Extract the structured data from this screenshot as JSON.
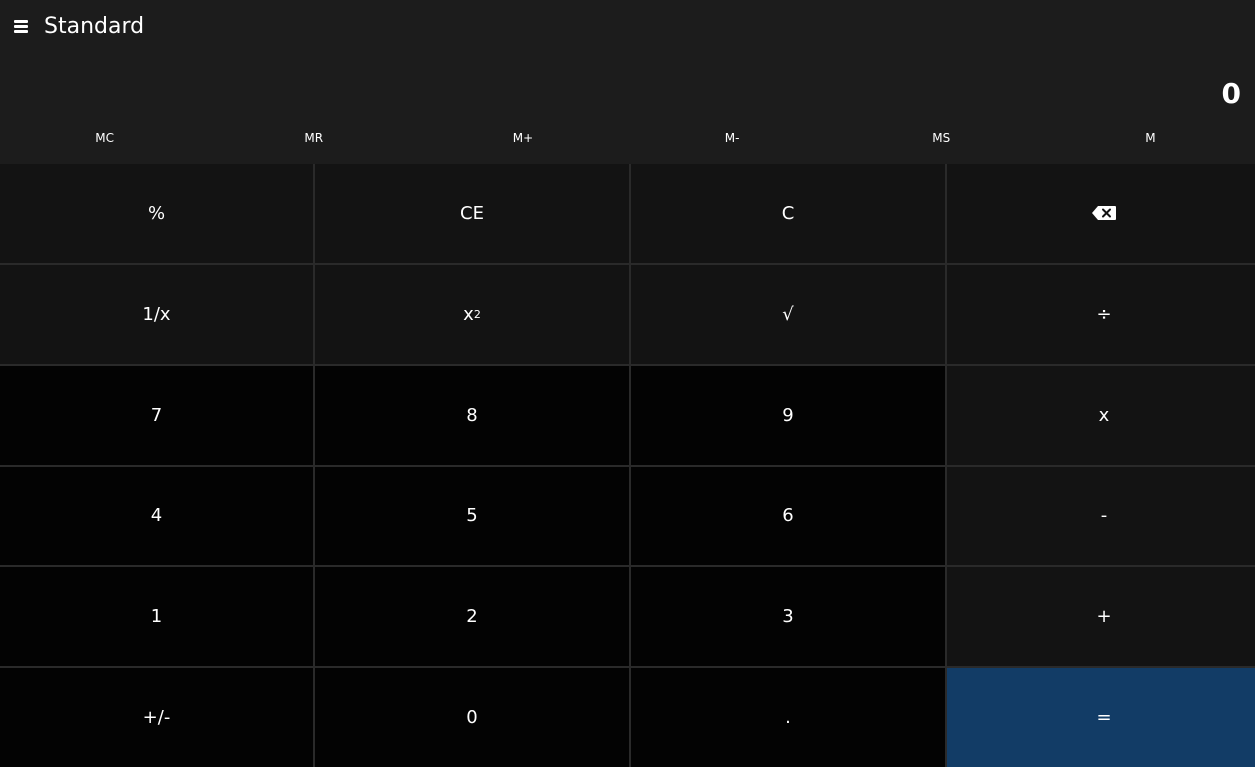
{
  "header": {
    "title": "Standard",
    "menu_icon": "hamburger-menu-icon"
  },
  "display": {
    "value": "0"
  },
  "memory": {
    "buttons": [
      "MC",
      "MR",
      "M+",
      "M-",
      "MS",
      "M"
    ]
  },
  "keys": {
    "percent": "%",
    "clear_entry": "CE",
    "clear": "C",
    "backspace_icon": "backspace-icon",
    "reciprocal": "1/x",
    "square_base": "x",
    "square_exp": "2",
    "sqrt": "√",
    "divide": "÷",
    "seven": "7",
    "eight": "8",
    "nine": "9",
    "multiply": "x",
    "four": "4",
    "five": "5",
    "six": "6",
    "minus": "-",
    "one": "1",
    "two": "2",
    "three": "3",
    "plus": "+",
    "negate": "+/-",
    "zero": "0",
    "decimal": ".",
    "equals": "="
  },
  "colors": {
    "background": "#1c1c1c",
    "operator_key": "#131313",
    "number_key": "#030303",
    "equals_key": "#123c66",
    "grid_line": "#2a2a2a"
  }
}
